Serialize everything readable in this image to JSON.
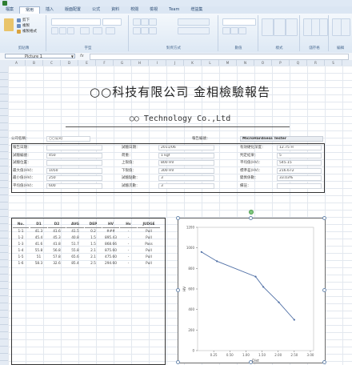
{
  "ribbon": {
    "tabs": [
      "檔案",
      "常用",
      "插入",
      "版面配置",
      "公式",
      "資料",
      "校閱",
      "檢視",
      "Team",
      "增益集"
    ],
    "group_labels": [
      "剪貼簿",
      "字型",
      "對齊方式",
      "數值",
      "樣式",
      "儲存格",
      "編輯"
    ],
    "buttons": [
      "剪下",
      "複製",
      "複製格式"
    ]
  },
  "formula_bar": {
    "name_box": "Picture 1",
    "fx": "fx"
  },
  "columns": [
    "A",
    "B",
    "C",
    "D",
    "E",
    "F",
    "G",
    "H",
    "I",
    "J",
    "K",
    "L",
    "M",
    "N",
    "O",
    "P",
    "Q",
    "R",
    "S"
  ],
  "report": {
    "title_zh": "○○科技有限公司 金相檢驗報告",
    "title_en": "○○ Technology Co.,Ltd"
  },
  "info": {
    "row0": {
      "label": "公司名稱：",
      "value": "○○公司",
      "label2": "報告編號：",
      "header_right": "MicroHardness Tester"
    },
    "left": [
      {
        "label": "報告日期：",
        "value": ""
      },
      {
        "label": "試驗編號：",
        "value": "450"
      },
      {
        "label": "試驗位置：",
        "value": ""
      },
      {
        "label": "最大值(HV)：",
        "value": "1050"
      },
      {
        "label": "最小值(HV)：",
        "value": "250"
      },
      {
        "label": "平均值(HV)：",
        "value": "600"
      }
    ],
    "mid": [
      {
        "label": "試驗日期：",
        "value": "2011/06"
      },
      {
        "label": "荷重：",
        "value": "1 kgf"
      },
      {
        "label": "上限值：",
        "value": "800 HV"
      },
      {
        "label": "下限值：",
        "value": "300 HV"
      },
      {
        "label": "試驗點數：",
        "value": "3"
      },
      {
        "label": "試驗次數：",
        "value": "3"
      }
    ],
    "right": [
      {
        "label": "有效硬化深度：",
        "value": "12.75 H"
      },
      {
        "label": "判定結果：",
        "value": "5"
      },
      {
        "label": "平均值(HV)：",
        "value": "545.15"
      },
      {
        "label": "標準差(HV)：",
        "value": "216.672"
      },
      {
        "label": "變異係數：",
        "value": "33.03%"
      },
      {
        "label": "備註：",
        "value": ""
      }
    ]
  },
  "table": {
    "headers": [
      "No.",
      "D1",
      "D2",
      "AVG",
      "DEP",
      "HV",
      "Hv",
      "JUDGE"
    ],
    "rows": [
      [
        "1-1",
        "41.3",
        "41.6",
        "41.5",
        "0.2",
        "###",
        "-",
        "Pull"
      ],
      [
        "1-2",
        "45.4",
        "45.3",
        "40.8",
        "1.5",
        "895.43",
        "-",
        "Pull"
      ],
      [
        "1-3",
        "41.6",
        "41.8",
        "51.7",
        "1.5",
        "868.66",
        "-",
        "Pass"
      ],
      [
        "1-4",
        "55.8",
        "56.8",
        "55.8",
        "2.1",
        "875.60",
        "-",
        "Pull"
      ],
      [
        "1-5",
        "51",
        "57.8",
        "65.6",
        "2.1",
        "475.60",
        "-",
        "Pull"
      ],
      [
        "1-6",
        "58.3",
        "32.6",
        "85.4",
        "2.5",
        "294.60",
        "-",
        "Pull"
      ]
    ]
  },
  "chart_data": {
    "type": "line",
    "title": "",
    "xlabel": "Dist",
    "ylabel": "HV",
    "x": [
      0.1,
      0.5,
      1.5,
      1.7,
      2.1,
      2.5
    ],
    "series": [
      {
        "values": [
          960,
          870,
          720,
          620,
          470,
          300
        ]
      }
    ],
    "xlim": [
      0,
      3.0
    ],
    "ylim": [
      0,
      1200
    ],
    "xticks": [
      "0.25",
      "0.50",
      "1.00",
      "1.50",
      "2.00",
      "2.50",
      "3.00"
    ],
    "yticks": [
      "0",
      "200",
      "400",
      "600",
      "800",
      "1000",
      "1200"
    ],
    "line_color": "#4f6fa5"
  },
  "colors": {
    "accent": "#2e7d32",
    "ribbon": "#dde8f4"
  }
}
